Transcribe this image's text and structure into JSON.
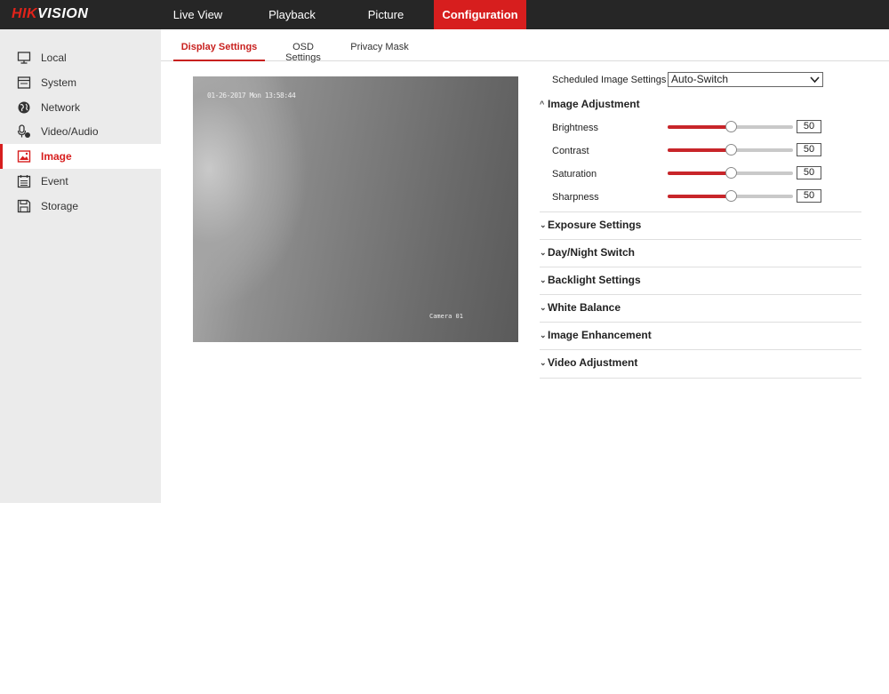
{
  "brand": {
    "hik": "HIK",
    "vision": "VISION"
  },
  "nav": {
    "live_view": "Live View",
    "playback": "Playback",
    "picture": "Picture",
    "configuration": "Configuration"
  },
  "sidebar": {
    "items": [
      {
        "label": "Local",
        "icon": "monitor-icon"
      },
      {
        "label": "System",
        "icon": "system-icon"
      },
      {
        "label": "Network",
        "icon": "globe-icon"
      },
      {
        "label": "Video/Audio",
        "icon": "microphone-icon"
      },
      {
        "label": "Image",
        "icon": "image-icon",
        "active": true
      },
      {
        "label": "Event",
        "icon": "calendar-icon"
      },
      {
        "label": "Storage",
        "icon": "floppy-icon"
      }
    ]
  },
  "tabs": {
    "display": "Display Settings",
    "osd": "OSD Settings",
    "privacy": "Privacy Mask"
  },
  "preview": {
    "osd_time": "01-26-2017 Mon 13:58:44",
    "osd_name": "Camera 01"
  },
  "schedule": {
    "label": "Scheduled Image Settings",
    "value": "Auto-Switch"
  },
  "image_adjustment": {
    "title": "Image Adjustment",
    "expanded": true,
    "sliders": [
      {
        "label": "Brightness",
        "value": "50",
        "fraction": 0.5
      },
      {
        "label": "Contrast",
        "value": "50",
        "fraction": 0.5
      },
      {
        "label": "Saturation",
        "value": "50",
        "fraction": 0.5
      },
      {
        "label": "Sharpness",
        "value": "50",
        "fraction": 0.5
      }
    ]
  },
  "sections": [
    "Exposure Settings",
    "Day/Night Switch",
    "Backlight Settings",
    "White Balance",
    "Image Enhancement",
    "Video Adjustment"
  ],
  "colors": {
    "accent": "#d71e1e",
    "topbar": "#262626",
    "sidebar": "#ebebeb",
    "slider_fill": "#c8252a"
  }
}
